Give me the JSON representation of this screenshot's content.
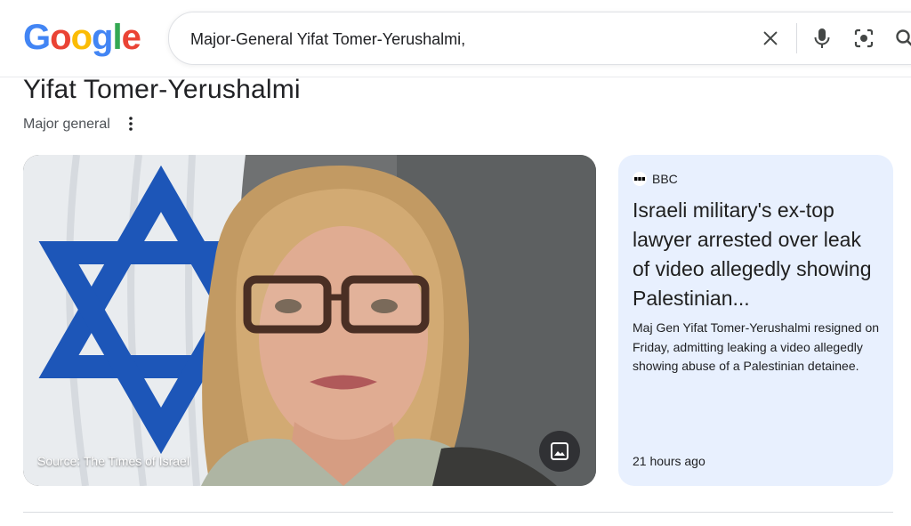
{
  "logo": {
    "letters": [
      "G",
      "o",
      "o",
      "g",
      "l",
      "e"
    ]
  },
  "search": {
    "query": "Major-General Yifat Tomer-Yerushalmi,"
  },
  "entity": {
    "title": "Yifat Tomer-Yerushalmi",
    "subtitle": "Major general"
  },
  "image_card": {
    "caption": "Source: The Times of Israel"
  },
  "news": {
    "source": "BBC",
    "headline": "Israeli military's ex-top lawyer arrested over leak of video allegedly showing Palestinian...",
    "snippet": "Maj Gen Yifat Tomer-Yerushalmi resigned on Friday, admitting leaking a video allegedly showing abuse of a Palestinian detainee.",
    "time": "21 hours ago"
  },
  "colors": {
    "blue": "#4285F4",
    "red": "#EA4335",
    "yellow": "#FBBC05",
    "green": "#34A853",
    "news_bg": "#e8f0fe"
  }
}
